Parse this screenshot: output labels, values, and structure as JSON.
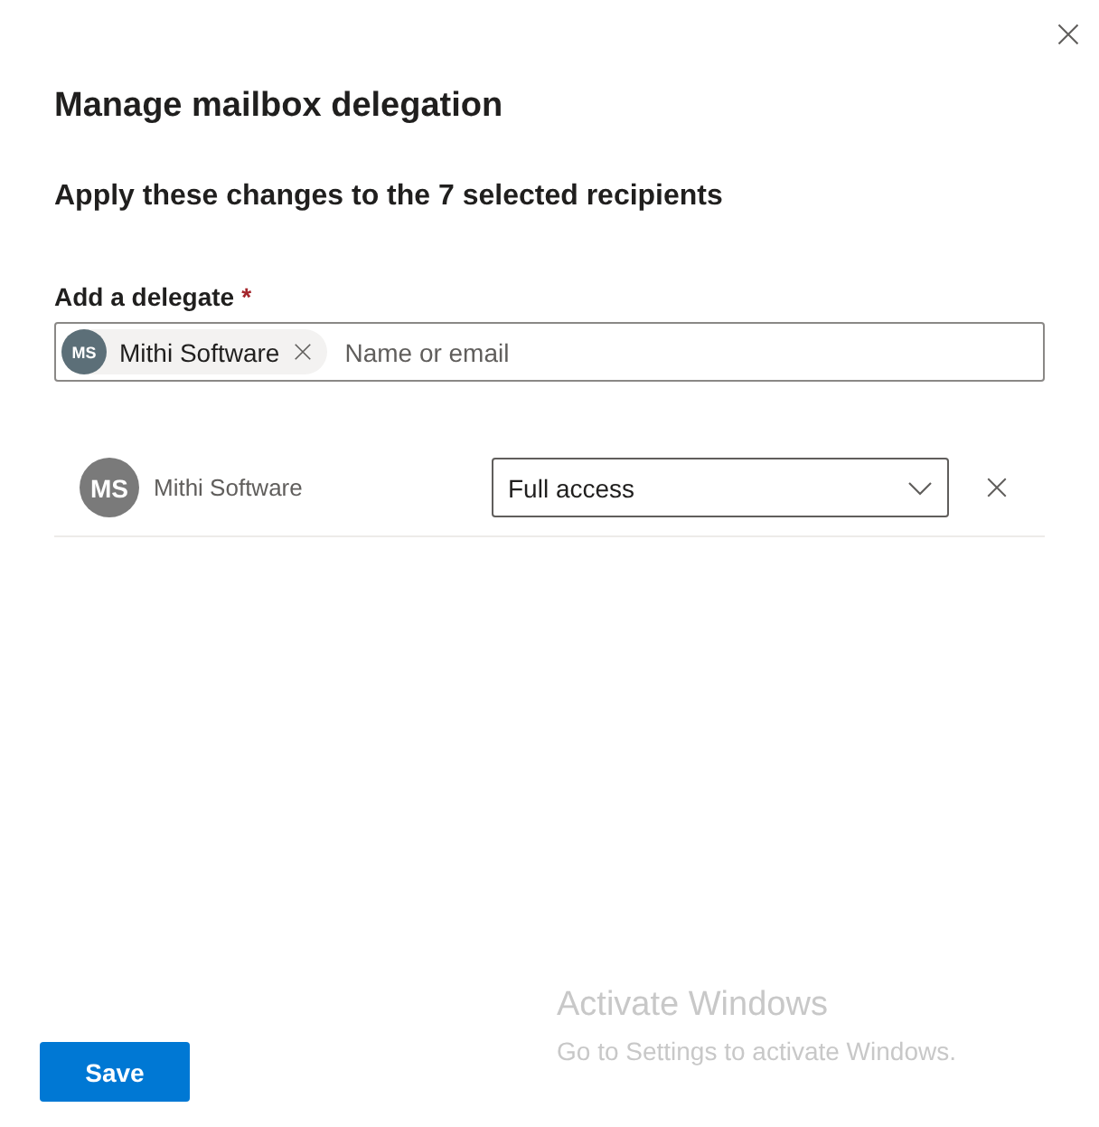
{
  "dialog": {
    "title": "Manage mailbox delegation",
    "subtitle": "Apply these changes to the 7 selected recipients"
  },
  "delegate_field": {
    "label": "Add a delegate",
    "required_mark": "*",
    "chips": [
      {
        "initials": "MS",
        "name": "Mithi Software"
      }
    ],
    "placeholder": "Name or email"
  },
  "delegates": [
    {
      "initials": "MS",
      "name": "Mithi Software",
      "permission": "Full access"
    }
  ],
  "buttons": [
    "Save"
  ],
  "os_overlay": {
    "title": "Activate Windows",
    "text": "Go to Settings to activate Windows."
  }
}
